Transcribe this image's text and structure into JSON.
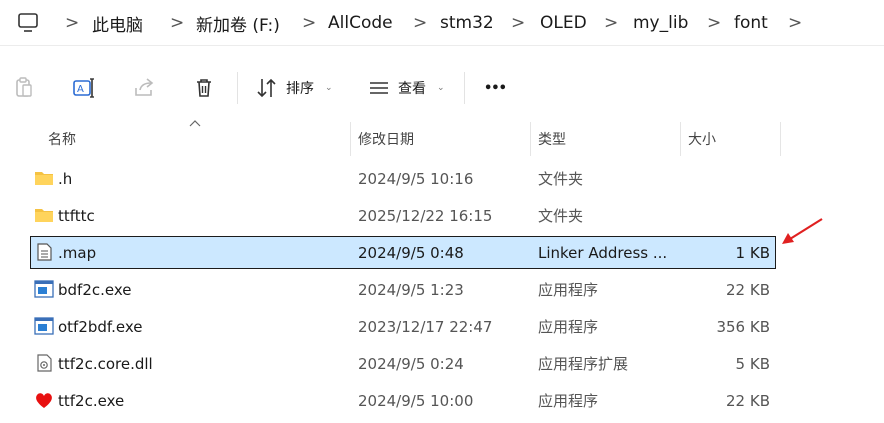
{
  "breadcrumb": {
    "items": [
      "此电脑",
      "新加卷 (F:)",
      "AllCode",
      "stm32",
      "OLED",
      "my_lib",
      "font"
    ],
    "separator": ">"
  },
  "toolbar": {
    "sort_label": "排序",
    "view_label": "查看",
    "more_label": "•••"
  },
  "columns": {
    "name": "名称",
    "date": "修改日期",
    "type": "类型",
    "size": "大小"
  },
  "files": [
    {
      "name": ".h",
      "date": "2024/9/5 10:16",
      "type": "文件夹",
      "size": "",
      "icon": "folder-icon"
    },
    {
      "name": "ttfttc",
      "date": "2025/12/22 16:15",
      "type": "文件夹",
      "size": "",
      "icon": "folder-icon"
    },
    {
      "name": ".map",
      "date": "2024/9/5 0:48",
      "type": "Linker Address ...",
      "size": "1 KB",
      "icon": "document-icon",
      "selected": true
    },
    {
      "name": "bdf2c.exe",
      "date": "2024/9/5 1:23",
      "type": "应用程序",
      "size": "22 KB",
      "icon": "exe-icon"
    },
    {
      "name": "otf2bdf.exe",
      "date": "2023/12/17 22:47",
      "type": "应用程序",
      "size": "356 KB",
      "icon": "exe-icon"
    },
    {
      "name": "ttf2c.core.dll",
      "date": "2024/9/5 0:24",
      "type": "应用程序扩展",
      "size": "5 KB",
      "icon": "dll-icon"
    },
    {
      "name": "ttf2c.exe",
      "date": "2024/9/5 10:00",
      "type": "应用程序",
      "size": "22 KB",
      "icon": "heart-icon"
    }
  ],
  "colors": {
    "selection_bg": "#cce8ff",
    "folder": "#f5c242",
    "annotation_arrow": "#e02020"
  }
}
